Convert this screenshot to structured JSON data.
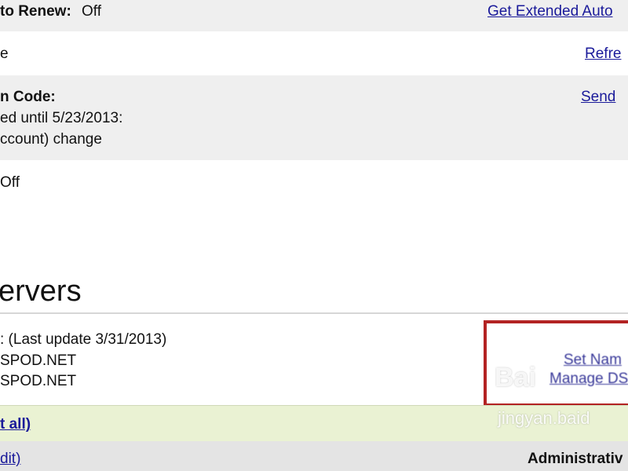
{
  "auto_renew": {
    "label": "to Renew:",
    "value": "Off",
    "link": "Get Extended Auto"
  },
  "status_row": {
    "value": "e",
    "link": "Refre"
  },
  "auth_code": {
    "label": "n Code:",
    "line1": "ed until 5/23/2013:",
    "line2": "ccount) change",
    "link": "Send"
  },
  "lock_row": {
    "value": "Off"
  },
  "nameservers": {
    "heading": "ervers",
    "label": ":  (Last update 3/31/2013)",
    "ns1": "SPOD.NET",
    "ns2": "SPOD.NET",
    "set_link": "Set Nam",
    "manage_link": "Manage DS"
  },
  "expand_row": {
    "link": "t all)"
  },
  "contact_row": {
    "edit_link": "dit)",
    "admin_label": "Administrativ"
  },
  "watermark": {
    "logo": "Bai",
    "sub": "jingyan.baid"
  }
}
